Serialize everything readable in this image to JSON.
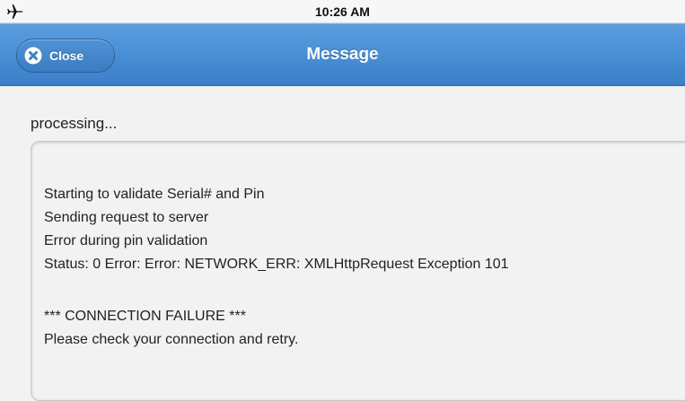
{
  "status_bar": {
    "time": "10:26 AM",
    "airplane_icon": "airplane-icon"
  },
  "header": {
    "title": "Message",
    "close_label": "Close",
    "close_icon": "close-icon",
    "accent_color": "#3a7fc8"
  },
  "main": {
    "status_text": "processing...",
    "log_lines": [
      "Starting to validate Serial# and Pin",
      "Sending request to server",
      "Error during pin validation",
      "Status: 0 Error: Error: NETWORK_ERR: XMLHttpRequest Exception 101",
      "*** CONNECTION FAILURE ***",
      "Please check your connection and retry."
    ]
  }
}
